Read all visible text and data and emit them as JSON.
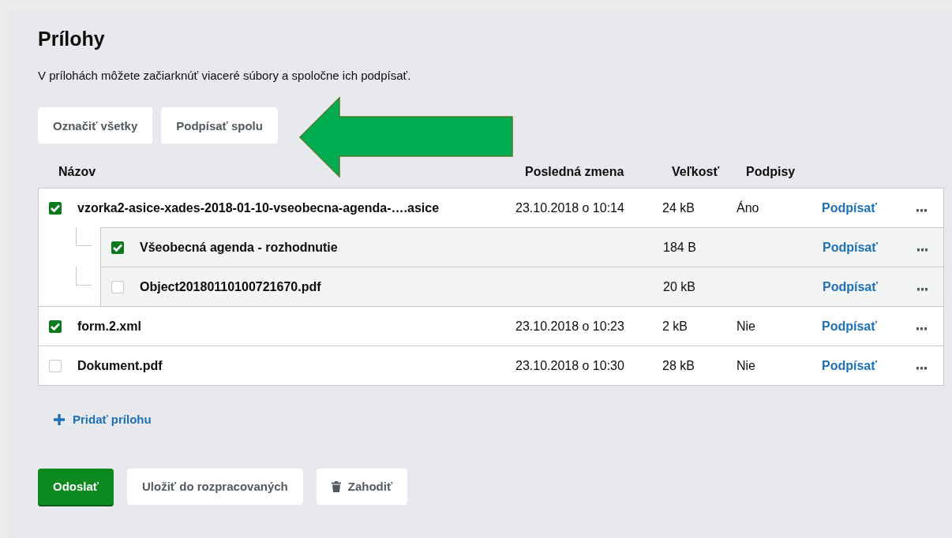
{
  "title": "Prílohy",
  "description": "V prílohách môžete začiarknúť viaceré súbory a spoločne ich podpísať.",
  "toolbar": [
    "Označiť všetky",
    "Podpísať spolu"
  ],
  "table": {
    "columns": [
      "Názov",
      "Posledná zmena",
      "Veľkosť",
      "Podpisy"
    ],
    "rows": [
      {
        "name": "vzorka2-asice-xades-2018-01-10-vseobecna-agenda-….asice",
        "checked": true,
        "modified": "23.10.2018 o 10:14",
        "size": "24 kB",
        "signatures": "Áno",
        "action": "Podpísať",
        "children": [
          {
            "name": "Všeobecná agenda - rozhodnutie",
            "checked": true,
            "size": "184 B",
            "action": "Podpísať"
          },
          {
            "name": "Object20180110100721670.pdf",
            "checked": false,
            "size": "20 kB",
            "action": "Podpísať"
          }
        ]
      },
      {
        "name": "form.2.xml",
        "checked": true,
        "modified": "23.10.2018 o 10:23",
        "size": "2 kB",
        "signatures": "Nie",
        "action": "Podpísať"
      },
      {
        "name": "Dokument.pdf",
        "checked": false,
        "modified": "23.10.2018 o 10:30",
        "size": "28 kB",
        "signatures": "Nie",
        "action": "Podpísať"
      }
    ]
  },
  "add_attachment": "Pridať prílohu",
  "buttons": [
    {
      "label": "Odoslať",
      "kind": "primary"
    },
    {
      "label": "Uložiť do rozpracovaných",
      "kind": "secondary"
    },
    {
      "label": "Zahodiť",
      "kind": "delete"
    }
  ]
}
